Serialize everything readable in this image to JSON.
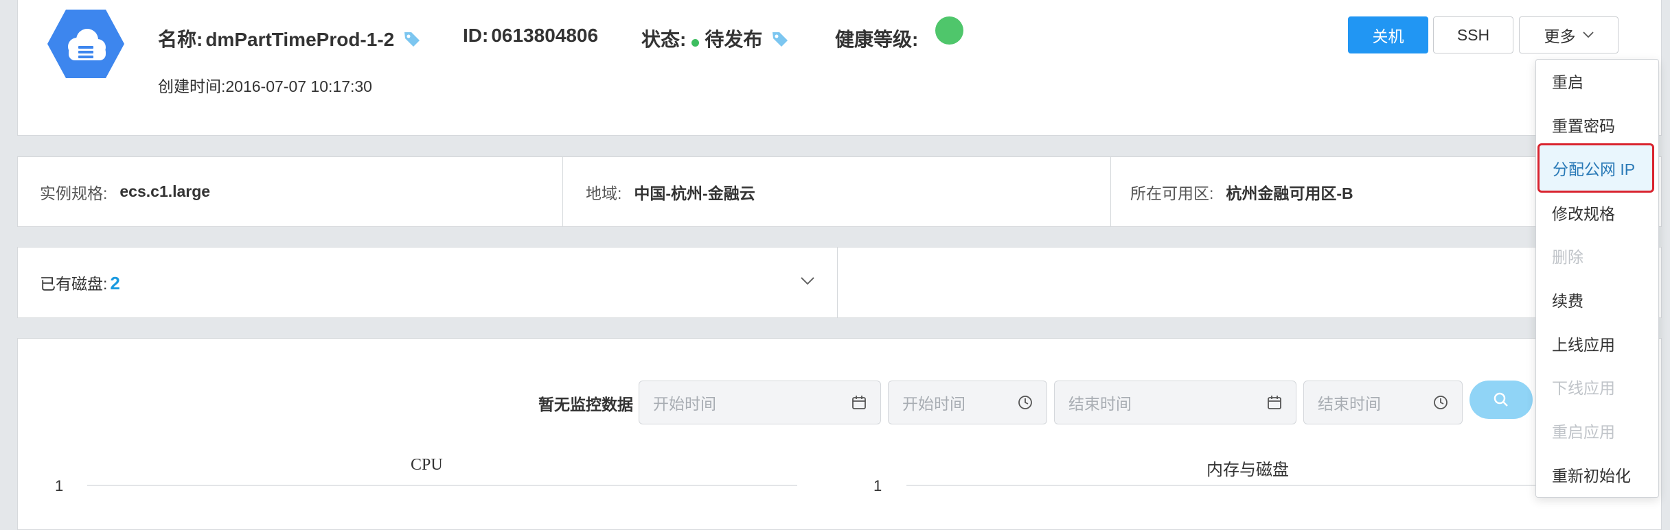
{
  "instance": {
    "name_label": "名称:",
    "name": "dmPartTimeProd-1-2",
    "id_label": "ID:",
    "id": "0613804806",
    "status_label": "状态:",
    "status": "待发布",
    "health_label": "健康等级:",
    "health_color": "#4fc66b",
    "created_label": "创建时间:",
    "created": "2016-07-07 10:17:30"
  },
  "actions": {
    "shutdown": "关机",
    "ssh": "SSH",
    "more": "更多"
  },
  "more_menu": [
    {
      "label": "重启",
      "disabled": false
    },
    {
      "label": "重置密码",
      "disabled": false
    },
    {
      "label": "分配公网 IP",
      "disabled": false,
      "highlighted": true
    },
    {
      "label": "修改规格",
      "disabled": false
    },
    {
      "label": "删除",
      "disabled": true
    },
    {
      "label": "续费",
      "disabled": false
    },
    {
      "label": "上线应用",
      "disabled": false
    },
    {
      "label": "下线应用",
      "disabled": true
    },
    {
      "label": "重启应用",
      "disabled": true
    },
    {
      "label": "重新初始化",
      "disabled": false
    }
  ],
  "specs": {
    "type_label": "实例规格:",
    "type": "ecs.c1.large",
    "region_label": "地域:",
    "region": "中国-杭州-金融云",
    "zone_label": "所在可用区:",
    "zone": "杭州金融可用区-B"
  },
  "disks": {
    "label": "已有磁盘:",
    "count": "2"
  },
  "monitor": {
    "empty_text": "暂无监控数据",
    "start_date_placeholder": "开始时间",
    "start_time_placeholder": "开始时间",
    "end_date_placeholder": "结束时间",
    "end_time_placeholder": "结束时间",
    "charts": [
      {
        "title": "CPU",
        "y_tick": "1"
      },
      {
        "title": "内存与磁盘",
        "y_tick": "1"
      }
    ]
  },
  "colors": {
    "primary": "#2196f3",
    "link": "#1a9ae0",
    "status_green": "#3dbd5f",
    "highlight_border": "#d9232e"
  }
}
